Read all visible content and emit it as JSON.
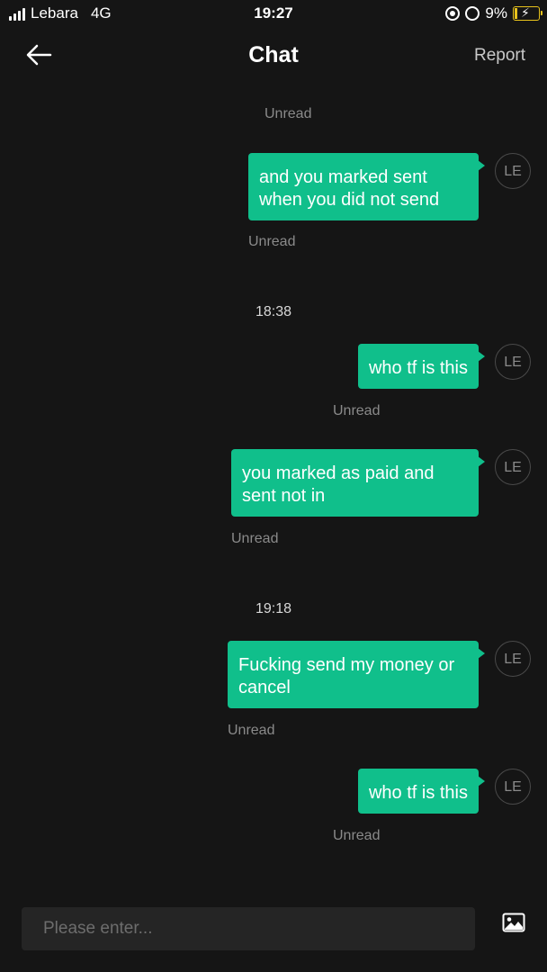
{
  "status_bar": {
    "carrier": "Lebara",
    "network": "4G",
    "time": "19:27",
    "battery": "9%"
  },
  "header": {
    "title": "Chat",
    "report_label": "Report"
  },
  "messages": [
    {
      "text": "",
      "avatar": "LE",
      "status": "Unread"
    },
    {
      "text": "and you marked sent when you did not send",
      "avatar": "LE",
      "status": "Unread"
    },
    {
      "text": "who tf is this",
      "avatar": "LE",
      "status": "Unread"
    },
    {
      "text": "you marked as paid and sent not in",
      "avatar": "LE",
      "status": "Unread"
    },
    {
      "text": "Fucking send my money or cancel",
      "avatar": "LE",
      "status": "Unread"
    },
    {
      "text": "who tf is this",
      "avatar": "LE",
      "status": "Unread"
    }
  ],
  "time_separators": [
    "18:38",
    "19:18"
  ],
  "input": {
    "placeholder": "Please enter..."
  },
  "colors": {
    "background": "#151515",
    "bubble": "#10bf8b",
    "muted_text": "#8a8a8a",
    "input_bg": "#252525"
  }
}
